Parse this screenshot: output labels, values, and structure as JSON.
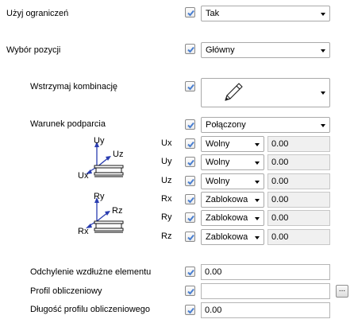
{
  "rows": {
    "use_limits": {
      "label": "Użyj ograniczeń",
      "checked": true,
      "value": "Tak"
    },
    "position_choice": {
      "label": "Wybór pozycji",
      "checked": true,
      "value": "Główny"
    },
    "suspend_combination": {
      "label": "Wstrzymaj kombinację",
      "checked": true,
      "icon": "pencil-icon"
    },
    "support_condition": {
      "label": "Warunek podparcia",
      "checked": true,
      "value": "Połączony"
    },
    "deviation": {
      "label": "Odchylenie wzdłużne elementu",
      "checked": true,
      "value": "0.00"
    },
    "design_profile": {
      "label": "Profil obliczeniowy",
      "checked": true,
      "value": "",
      "button": "..."
    },
    "design_profile_length": {
      "label": "Długość profilu obliczeniowego",
      "checked": true,
      "value": "0.00"
    }
  },
  "dofs": [
    {
      "name": "Ux",
      "checked": true,
      "mode": "Wolny",
      "value": "0.00"
    },
    {
      "name": "Uy",
      "checked": true,
      "mode": "Wolny",
      "value": "0.00"
    },
    {
      "name": "Uz",
      "checked": true,
      "mode": "Wolny",
      "value": "0.00"
    },
    {
      "name": "Rx",
      "checked": true,
      "mode": "Zablokowa",
      "value": "0.00"
    },
    {
      "name": "Ry",
      "checked": true,
      "mode": "Zablokowa",
      "value": "0.00"
    },
    {
      "name": "Rz",
      "checked": true,
      "mode": "Zablokowa",
      "value": "0.00"
    }
  ],
  "diagrams": {
    "translation": {
      "uy": "Uy",
      "uz": "Uz",
      "ux": "Ux"
    },
    "rotation": {
      "ry": "Ry",
      "rz": "Rz",
      "rx": "Rx"
    }
  },
  "colors": {
    "check": "#4a7fd0",
    "axis": "#2a3db0",
    "field_border": "#b5b5b5"
  }
}
